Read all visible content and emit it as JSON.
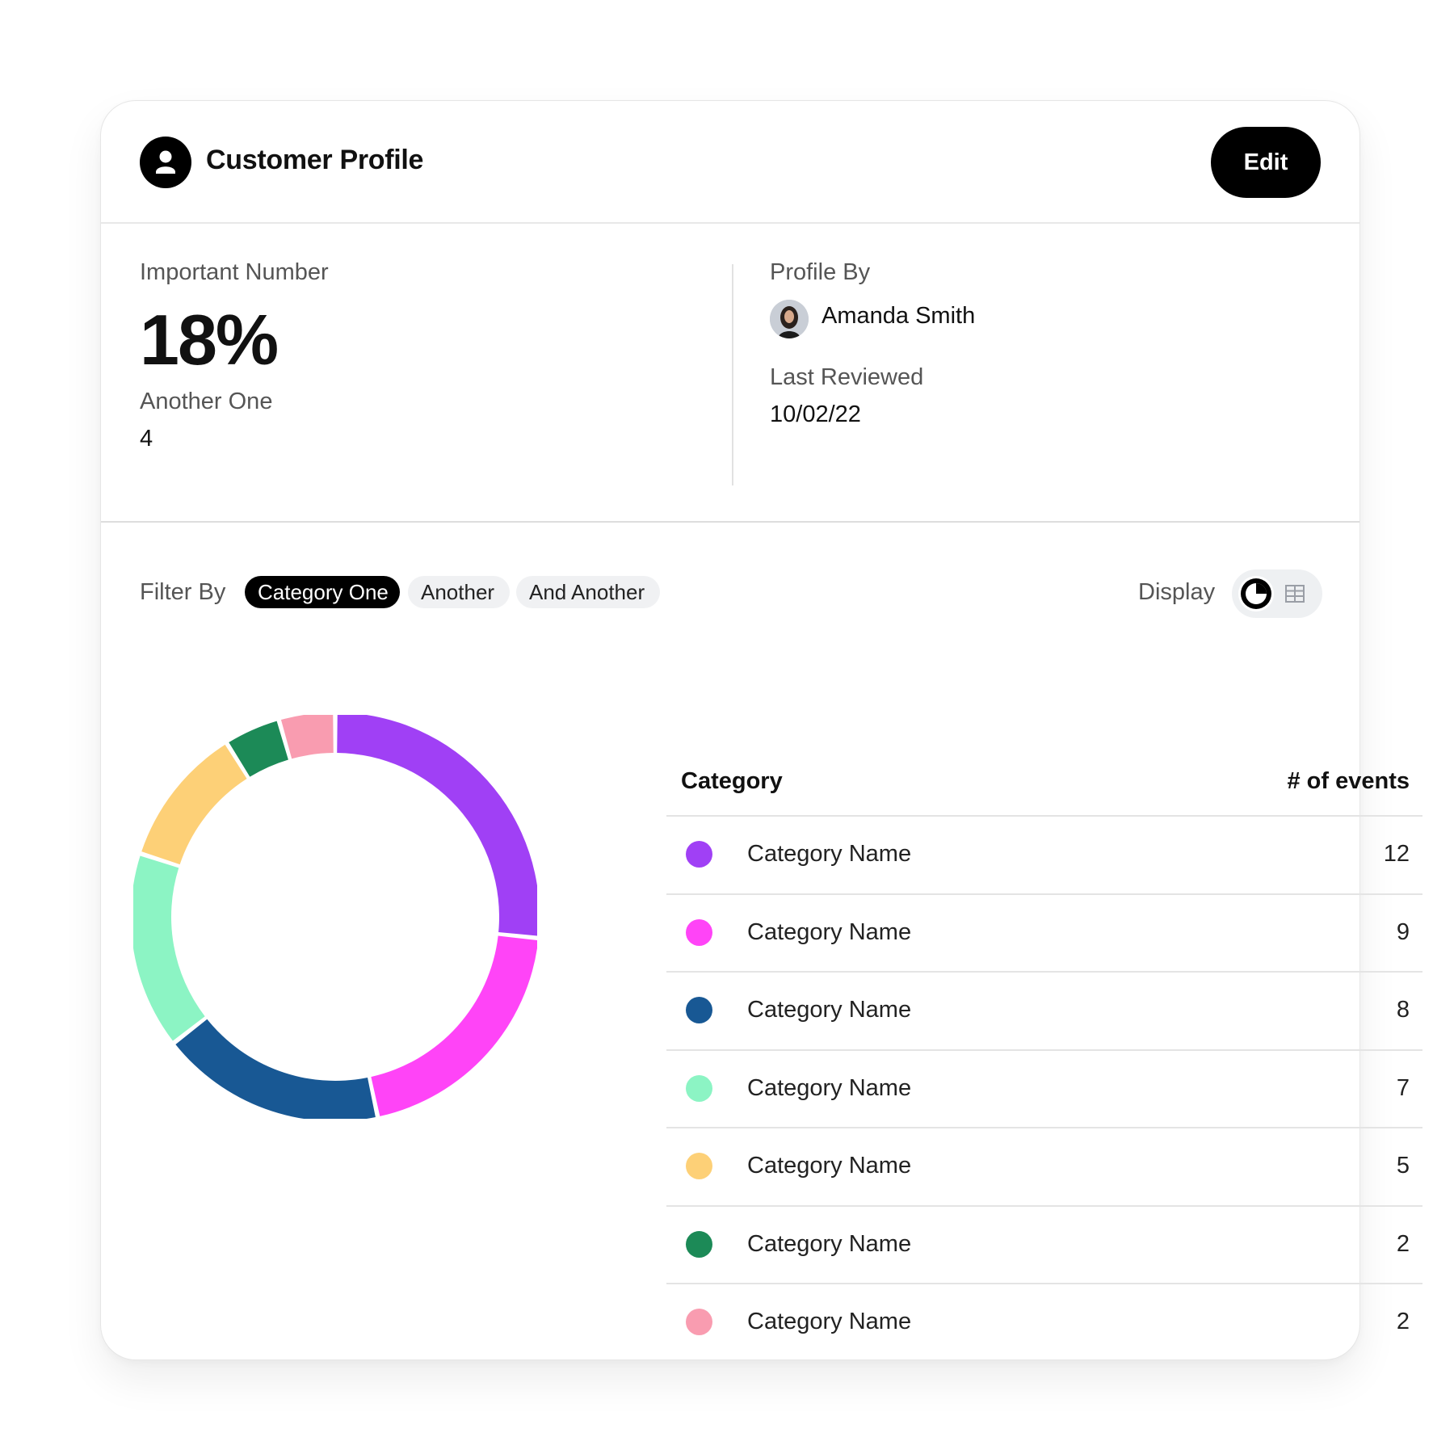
{
  "header": {
    "title": "Customer Profile",
    "edit_label": "Edit",
    "icon": "person-icon"
  },
  "stats": {
    "important_label": "Important Number",
    "important_value": "18%",
    "another_label": "Another One",
    "another_value": "4",
    "profile_by_label": "Profile By",
    "profile_by_name": "Amanda Smith",
    "last_reviewed_label": "Last Reviewed",
    "last_reviewed_value": "10/02/22"
  },
  "filter": {
    "label": "Filter By",
    "chips": [
      {
        "label": "Category One",
        "active": true
      },
      {
        "label": "Another",
        "active": false
      },
      {
        "label": "And Another",
        "active": false
      }
    ]
  },
  "display": {
    "label": "Display",
    "selected": "pie-chart-icon",
    "options": [
      "pie-chart-icon",
      "table-icon"
    ]
  },
  "table": {
    "col_category": "Category",
    "col_events": "# of events"
  },
  "chart_data": {
    "type": "pie",
    "categories": [
      "Category Name",
      "Category Name",
      "Category Name",
      "Category Name",
      "Category Name",
      "Category Name",
      "Category Name"
    ],
    "values": [
      12,
      9,
      8,
      7,
      5,
      2,
      2
    ],
    "colors": [
      "#a040f5",
      "#ff44f7",
      "#185894",
      "#8cf4c4",
      "#fdd077",
      "#1c8a57",
      "#f99cb0"
    ],
    "title": ""
  }
}
